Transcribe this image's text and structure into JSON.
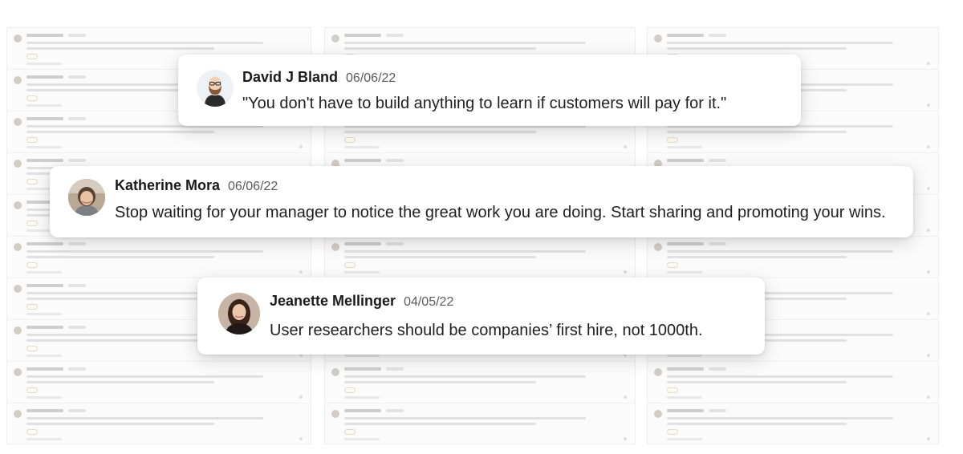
{
  "quotes": [
    {
      "author": "David J Bland",
      "date": "06/06/22",
      "text": "\"You don't have to build anything to learn if customers will pay for it.\"",
      "avatar_icon": "bald-bearded-man-avatar-icon"
    },
    {
      "author": "Katherine Mora",
      "date": "06/06/22",
      "text": "Stop waiting for your manager to notice the great work you are doing. Start sharing and promoting your wins.",
      "avatar_icon": "woman-photo-avatar"
    },
    {
      "author": "Jeanette Mellinger",
      "date": "04/05/22",
      "text": "User researchers should be companies’ first hire, not 1000th.",
      "avatar_icon": "woman-photo-avatar"
    }
  ],
  "colors": {
    "card_background": "#ffffff",
    "author_text": "#1a1a1a",
    "date_text": "#5a5a5a",
    "body_text": "#1f1f1f",
    "background_feed": "#fbfbfb"
  }
}
